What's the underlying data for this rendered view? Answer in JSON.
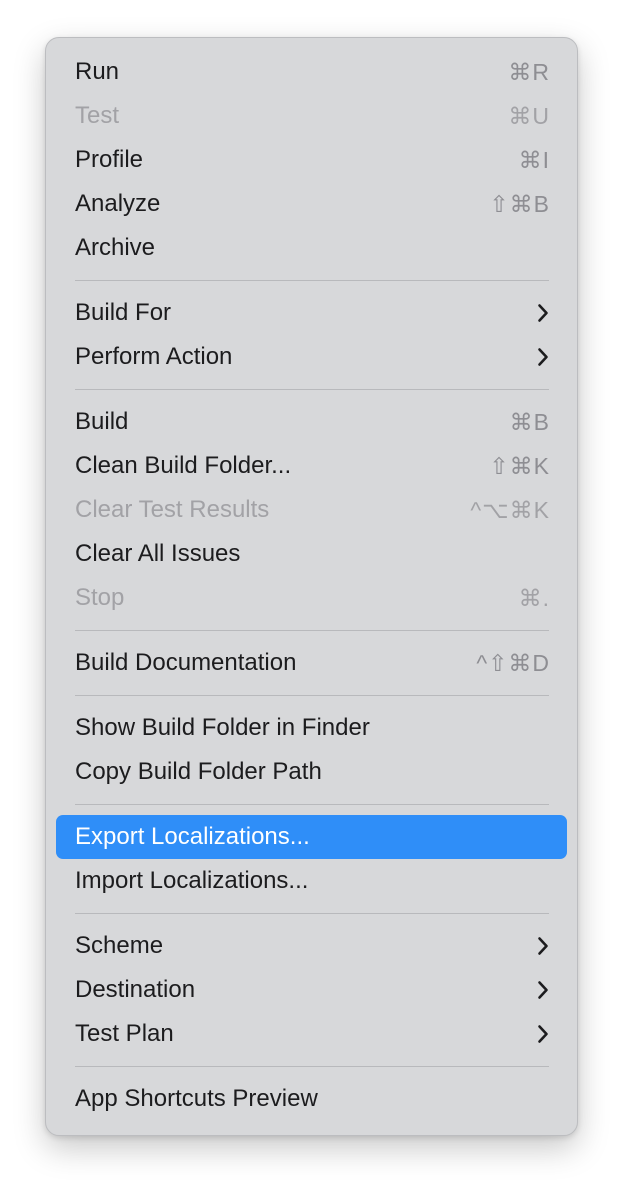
{
  "menu": {
    "groups": [
      [
        {
          "label": "Run",
          "shortcut": "⌘R",
          "disabled": false
        },
        {
          "label": "Test",
          "shortcut": "⌘U",
          "disabled": true
        },
        {
          "label": "Profile",
          "shortcut": "⌘I",
          "disabled": false
        },
        {
          "label": "Analyze",
          "shortcut": "⇧⌘B",
          "disabled": false
        },
        {
          "label": "Archive",
          "shortcut": "",
          "disabled": false
        }
      ],
      [
        {
          "label": "Build For",
          "submenu": true,
          "disabled": false
        },
        {
          "label": "Perform Action",
          "submenu": true,
          "disabled": false
        }
      ],
      [
        {
          "label": "Build",
          "shortcut": "⌘B",
          "disabled": false
        },
        {
          "label": "Clean Build Folder...",
          "shortcut": "⇧⌘K",
          "disabled": false
        },
        {
          "label": "Clear Test Results",
          "shortcut": "^⌥⌘K",
          "disabled": true
        },
        {
          "label": "Clear All Issues",
          "shortcut": "",
          "disabled": false
        },
        {
          "label": "Stop",
          "shortcut": "⌘.",
          "disabled": true
        }
      ],
      [
        {
          "label": "Build Documentation",
          "shortcut": "^⇧⌘D",
          "disabled": false
        }
      ],
      [
        {
          "label": "Show Build Folder in Finder",
          "shortcut": "",
          "disabled": false
        },
        {
          "label": "Copy Build Folder Path",
          "shortcut": "",
          "disabled": false
        }
      ],
      [
        {
          "label": "Export Localizations...",
          "shortcut": "",
          "disabled": false,
          "highlighted": true
        },
        {
          "label": "Import Localizations...",
          "shortcut": "",
          "disabled": false
        }
      ],
      [
        {
          "label": "Scheme",
          "submenu": true,
          "disabled": false
        },
        {
          "label": "Destination",
          "submenu": true,
          "disabled": false
        },
        {
          "label": "Test Plan",
          "submenu": true,
          "disabled": false
        }
      ],
      [
        {
          "label": "App Shortcuts Preview",
          "shortcut": "",
          "disabled": false
        }
      ]
    ]
  },
  "colors": {
    "highlight": "#2f8ef8",
    "menu_background": "#d7d8da",
    "disabled_text": "#a2a2a6"
  },
  "icons": {
    "submenu": "chevron-right-icon"
  }
}
